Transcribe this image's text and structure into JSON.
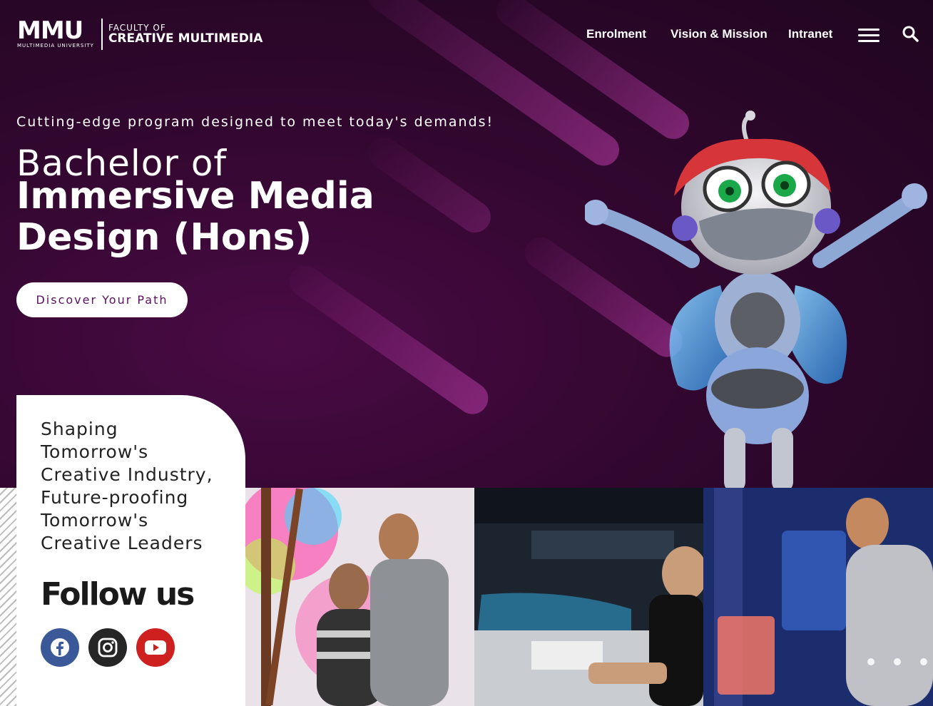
{
  "header": {
    "logo_mark": "MMU",
    "logo_sub": "MULTIMEDIA UNIVERSITY",
    "faculty_line1": "FACULTY OF",
    "faculty_line2": "CREATIVE MULTIMEDIA",
    "nav": [
      {
        "label": "Enrolment"
      },
      {
        "label": "Vision & Mission"
      },
      {
        "label": "Intranet"
      }
    ]
  },
  "hero": {
    "tagline": "Cutting-edge program designed to meet today's demands!",
    "title_light": "Bachelor of",
    "title_bold": "Immersive Media Design (Hons)",
    "cta_label": "Discover Your Path"
  },
  "card": {
    "text": "Shaping Tomorrow's Creative Industry, Future-proofing Tomorrow's Creative Leaders",
    "follow_label": "Follow us",
    "social": [
      {
        "icon": "facebook-icon",
        "color": "#3b5998"
      },
      {
        "icon": "instagram-icon",
        "color": "#262626"
      },
      {
        "icon": "youtube-icon",
        "color": "#cd201f"
      }
    ]
  },
  "colors": {
    "hero_bg": "#32072f",
    "cta_text": "#5a0f60"
  }
}
